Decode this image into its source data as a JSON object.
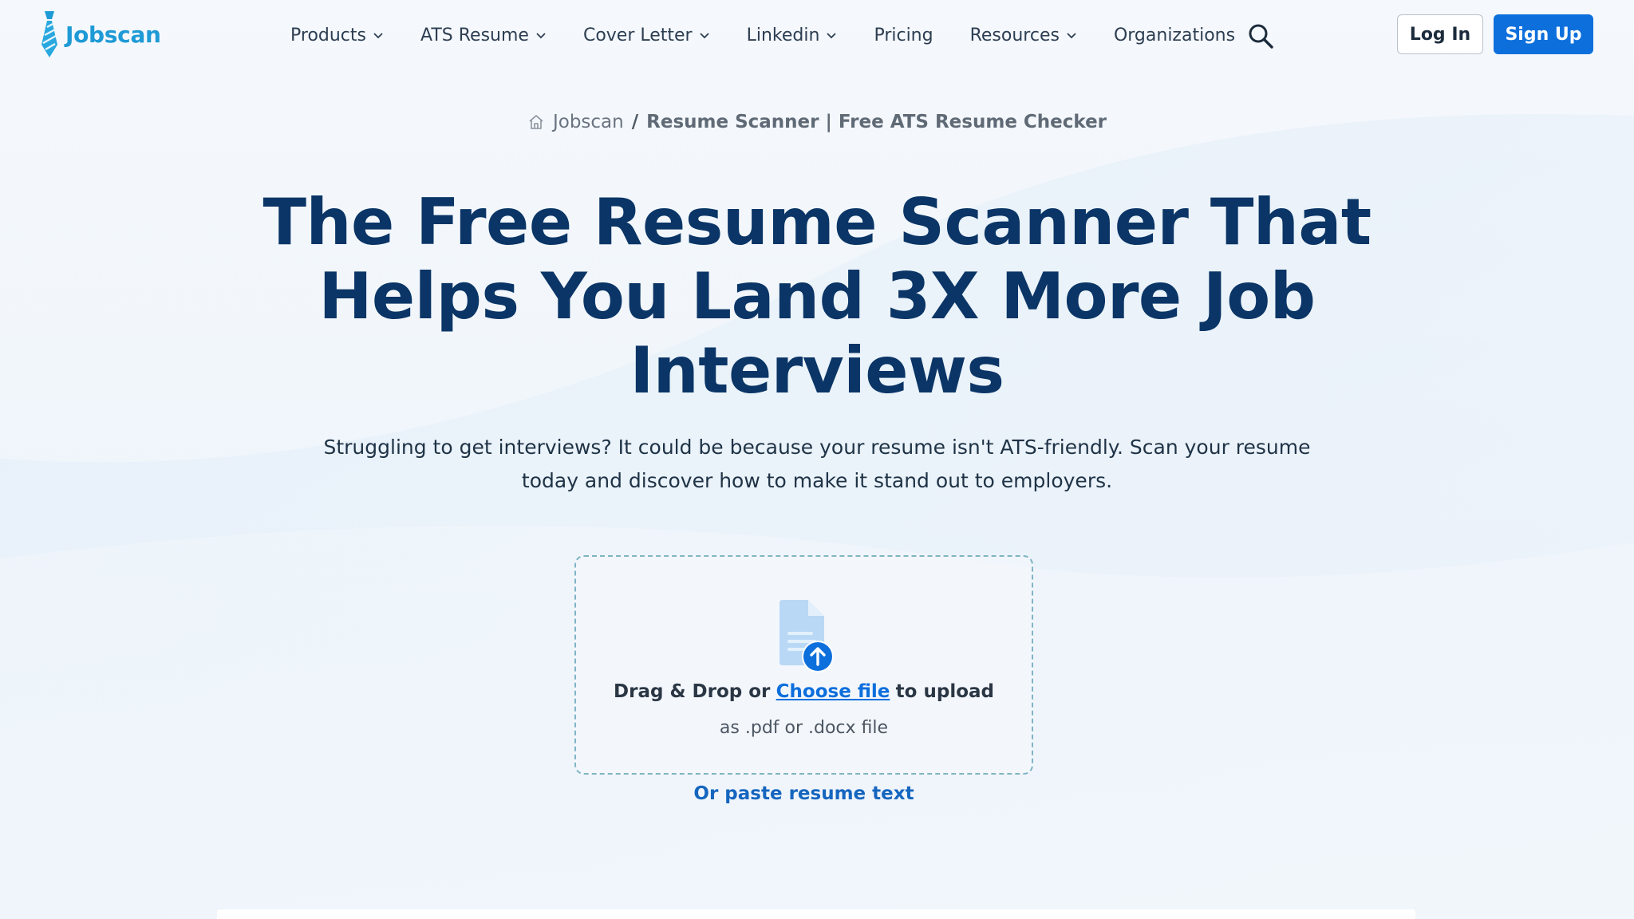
{
  "header": {
    "logo_text": "Jobscan",
    "nav": [
      {
        "label": "Products",
        "has_dropdown": true
      },
      {
        "label": "ATS Resume",
        "has_dropdown": true
      },
      {
        "label": "Cover Letter",
        "has_dropdown": true
      },
      {
        "label": "Linkedin",
        "has_dropdown": true
      },
      {
        "label": "Pricing",
        "has_dropdown": false
      },
      {
        "label": "Resources",
        "has_dropdown": true
      },
      {
        "label": "Organizations",
        "has_dropdown": false
      }
    ],
    "search_icon": "search-icon",
    "login_label": "Log In",
    "signup_label": "Sign Up"
  },
  "breadcrumb": {
    "home_icon": "home-icon",
    "root": "Jobscan",
    "separator": "/",
    "current": "Resume Scanner | Free ATS Resume Checker"
  },
  "hero": {
    "title": "The Free Resume Scanner That Helps You Land 3X More Job Interviews",
    "subtitle": "Struggling to get interviews? It could be because your resume isn't ATS-friendly. Scan your resume today and discover how to make it stand out to employers."
  },
  "upload": {
    "icon": "document-upload-icon",
    "drag_text": "Drag & Drop or",
    "choose_link": "Choose file",
    "after_text": "to upload",
    "hint": "as .pdf or .docx file",
    "paste_link": "Or paste resume text"
  },
  "colors": {
    "brand": "#1e9ad6",
    "primary_button": "#0d6fdc",
    "heading": "#0a3566",
    "link": "#0d6fdc"
  }
}
